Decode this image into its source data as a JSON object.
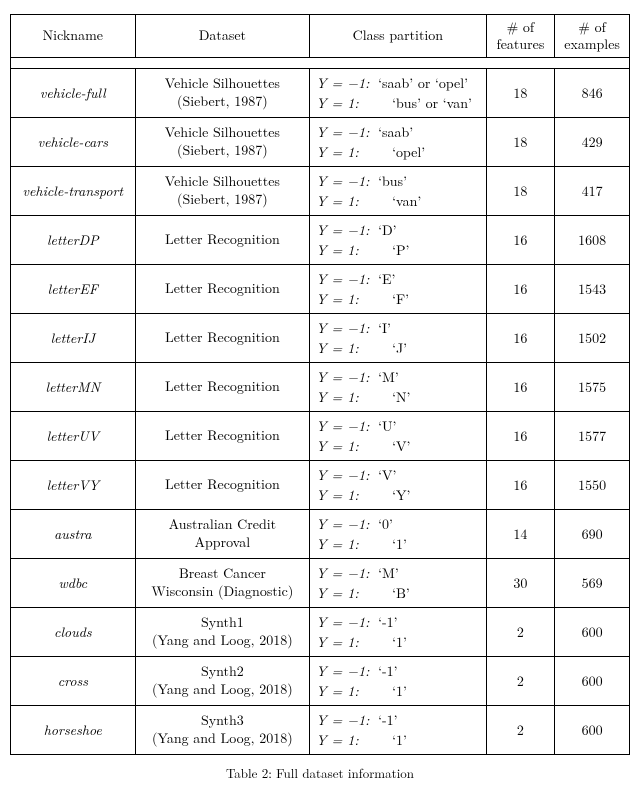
{
  "headers": {
    "nickname": "Nickname",
    "dataset": "Dataset",
    "partition": "Class partition",
    "features": "# of\nfeatures",
    "examples": "# of\nexamples"
  },
  "rows": [
    {
      "nickname": "vehicle-full",
      "dataset": "Vehicle Silhouettes\n(Siebert, 1987)",
      "partition": [
        {
          "l": "Y = −1:",
          "r": "‘saab’ or ‘opel’"
        },
        {
          "l": "Y = 1:",
          "r": "  ‘bus’ or ‘van’"
        }
      ],
      "features": "18",
      "examples": "846"
    },
    {
      "nickname": "vehicle-cars",
      "dataset": "Vehicle Silhouettes\n(Siebert, 1987)",
      "partition": [
        {
          "l": "Y = −1:",
          "r": "‘saab’"
        },
        {
          "l": "Y = 1:",
          "r": "  ‘opel’"
        }
      ],
      "features": "18",
      "examples": "429"
    },
    {
      "nickname": "vehicle-transport",
      "dataset": "Vehicle Silhouettes\n(Siebert, 1987)",
      "partition": [
        {
          "l": "Y = −1:",
          "r": "‘bus’"
        },
        {
          "l": "Y = 1:",
          "r": "  ‘van’"
        }
      ],
      "features": "18",
      "examples": "417"
    },
    {
      "nickname": "letterDP",
      "dataset": "Letter Recognition",
      "partition": [
        {
          "l": "Y = −1:",
          "r": "‘D’"
        },
        {
          "l": "Y = 1:",
          "r": "  ‘P’"
        }
      ],
      "features": "16",
      "examples": "1608"
    },
    {
      "nickname": "letterEF",
      "dataset": "Letter Recognition",
      "partition": [
        {
          "l": "Y = −1:",
          "r": "‘E’"
        },
        {
          "l": "Y = 1:",
          "r": "  ‘F’"
        }
      ],
      "features": "16",
      "examples": "1543"
    },
    {
      "nickname": "letterIJ",
      "dataset": "Letter Recognition",
      "partition": [
        {
          "l": "Y = −1:",
          "r": "‘I’"
        },
        {
          "l": "Y = 1:",
          "r": "  ‘J’"
        }
      ],
      "features": "16",
      "examples": "1502"
    },
    {
      "nickname": "letterMN",
      "dataset": "Letter Recognition",
      "partition": [
        {
          "l": "Y = −1:",
          "r": "‘M’"
        },
        {
          "l": "Y = 1:",
          "r": "  ‘N’"
        }
      ],
      "features": "16",
      "examples": "1575"
    },
    {
      "nickname": "letterUV",
      "dataset": "Letter Recognition",
      "partition": [
        {
          "l": "Y = −1:",
          "r": "‘U’"
        },
        {
          "l": "Y = 1:",
          "r": "  ‘V’"
        }
      ],
      "features": "16",
      "examples": "1577"
    },
    {
      "nickname": "letterVY",
      "dataset": "Letter Recognition",
      "partition": [
        {
          "l": "Y = −1:",
          "r": "‘V’"
        },
        {
          "l": "Y = 1:",
          "r": "  ‘Y’"
        }
      ],
      "features": "16",
      "examples": "1550"
    },
    {
      "nickname": "austra",
      "dataset": "Australian Credit\nApproval",
      "partition": [
        {
          "l": "Y = −1:",
          "r": "‘0’"
        },
        {
          "l": "Y = 1:",
          "r": "  ‘1’"
        }
      ],
      "features": "14",
      "examples": "690"
    },
    {
      "nickname": "wdbc",
      "dataset": "Breast Cancer\nWisconsin (Diagnostic)",
      "partition": [
        {
          "l": "Y = −1:",
          "r": "‘M’"
        },
        {
          "l": "Y = 1:",
          "r": "  ‘B’"
        }
      ],
      "features": "30",
      "examples": "569"
    },
    {
      "nickname": "clouds",
      "dataset": "Synth1\n(Yang and Loog, 2018)",
      "partition": [
        {
          "l": "Y = −1:",
          "r": "‘-1’"
        },
        {
          "l": "Y = 1:",
          "r": "  ‘1’"
        }
      ],
      "features": "2",
      "examples": "600"
    },
    {
      "nickname": "cross",
      "dataset": "Synth2\n(Yang and Loog, 2018)",
      "partition": [
        {
          "l": "Y = −1:",
          "r": "‘-1’"
        },
        {
          "l": "Y = 1:",
          "r": "  ‘1’"
        }
      ],
      "features": "2",
      "examples": "600"
    },
    {
      "nickname": "horseshoe",
      "dataset": "Synth3\n(Yang and Loog, 2018)",
      "partition": [
        {
          "l": "Y = −1:",
          "r": "‘-1’"
        },
        {
          "l": "Y = 1:",
          "r": "  ‘1’"
        }
      ],
      "features": "2",
      "examples": "600"
    }
  ],
  "caption": "Table 2: Full dataset information"
}
